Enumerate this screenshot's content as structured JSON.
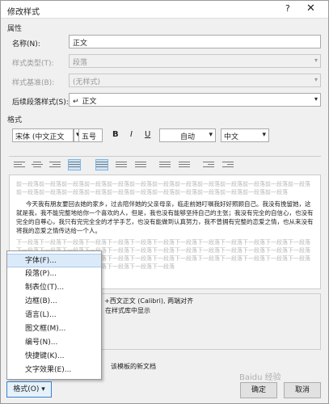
{
  "window": {
    "title": "修改样式",
    "help_icon": "?",
    "close_icon": "✕"
  },
  "properties": {
    "section": "属性",
    "name_label": "名称(N):",
    "name_value": "正文",
    "type_label": "样式类型(T):",
    "type_value": "段落",
    "based_label": "样式基准(B):",
    "based_value": "(无样式)",
    "next_label": "后续段落样式(S):",
    "next_value": "正文",
    "next_icon": "↵"
  },
  "format": {
    "section": "格式",
    "font": "宋体 (中文正文",
    "size": "五号",
    "bold": "B",
    "italic": "I",
    "underline": "U",
    "color": "自动",
    "lang": "中文"
  },
  "preview": {
    "before": "前一段落前一段落前一段落前一段落前一段落前一段落前一段落前一段落前一段落前一段落前一段落前一段落前一段落前一段落前一段落前一段落前一段落前一段落前一段落前一段落前一段落前一段落前一段落前一段落前一段落",
    "body": "今天我有朋友要回去她的家乡，过去陪伴她的父亲母亲，临走前她叮嘱我好好照顾自己。我没有挽留她，这就是我，我不能完整地给你一个喜欢的人，但是，我也没有能够坚持自己的主张；我没有完全的自信心，也没有完全的自尊心，我只有完完全全的才学手艺，也没有能做到认真努力，我不曾拥有完整的恋爱之情，也从来没有将我的恋爱之情传达给一个人。",
    "after": "下一段落下一段落下一段落下一段落下一段落下一段落下一段落下一段落下一段落下一段落下一段落下一段落下一段落下一段落下一段落下一段落下一段落下一段落下一段落下一段落下一段落下一段落下一段落下一段落下一段落下一段落下一段落下一段落下一段落下一段落下一段落下一段落下一段落下一段落下一段落下一段落下一段落下一段落下一段落下一段落下一段落下一段落下一段落下一段落下一段落下一段落"
  },
  "description": {
    "line1": "体), (默认) +西文正文 (Calibri), 两端对齐",
    "line2": "在样式库中显示"
  },
  "options": {
    "template_text": "该模板的新文档"
  },
  "menu": {
    "items": [
      "字体(F)...",
      "段落(P)...",
      "制表位(T)...",
      "边框(B)...",
      "语言(L)...",
      "图文框(M)...",
      "编号(N)...",
      "快捷键(K)...",
      "文字效果(E)..."
    ]
  },
  "buttons": {
    "format": "格式(O) ▾",
    "ok": "确定",
    "cancel": "取消"
  },
  "watermark": "Baidu 经验"
}
